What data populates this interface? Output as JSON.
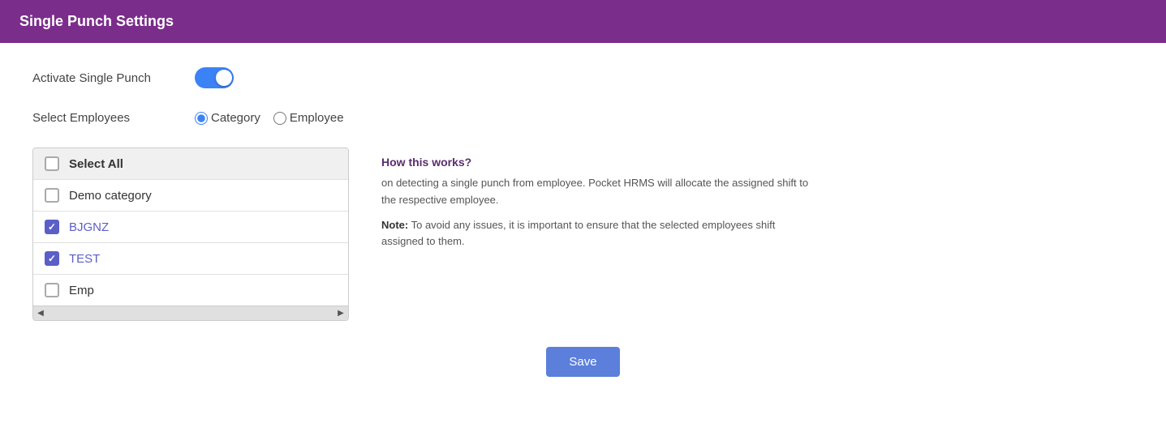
{
  "header": {
    "title": "Single Punch Settings"
  },
  "form": {
    "activate_label": "Activate Single Punch",
    "select_employees_label": "Select Employees",
    "toggle_active": true,
    "radio_options": [
      {
        "id": "radio-category",
        "label": "Category",
        "checked": true
      },
      {
        "id": "radio-employee",
        "label": "Employee",
        "checked": false
      }
    ],
    "list_items": [
      {
        "id": "select-all",
        "label": "Select All",
        "checked": false,
        "bold": true,
        "style": "select-all"
      },
      {
        "id": "demo-category",
        "label": "Demo category",
        "checked": false,
        "blue": false
      },
      {
        "id": "bjgnz",
        "label": "BJGNZ",
        "checked": true,
        "blue": true
      },
      {
        "id": "test",
        "label": "TEST",
        "checked": true,
        "blue": true
      },
      {
        "id": "emp",
        "label": "Emp",
        "checked": false,
        "blue": false
      }
    ]
  },
  "info_panel": {
    "title": "How this works?",
    "text": "on detecting a single punch from employee. Pocket HRMS will allocate the assigned shift to the respective employee.",
    "note_label": "Note:",
    "note_text": "To avoid any issues, it is important to ensure that the selected employees shift assigned to them."
  },
  "save_button": "Save",
  "icons": {
    "left_arrow": "◀",
    "right_arrow": "▶",
    "up_arrow": "▲",
    "down_arrow": "▼"
  }
}
